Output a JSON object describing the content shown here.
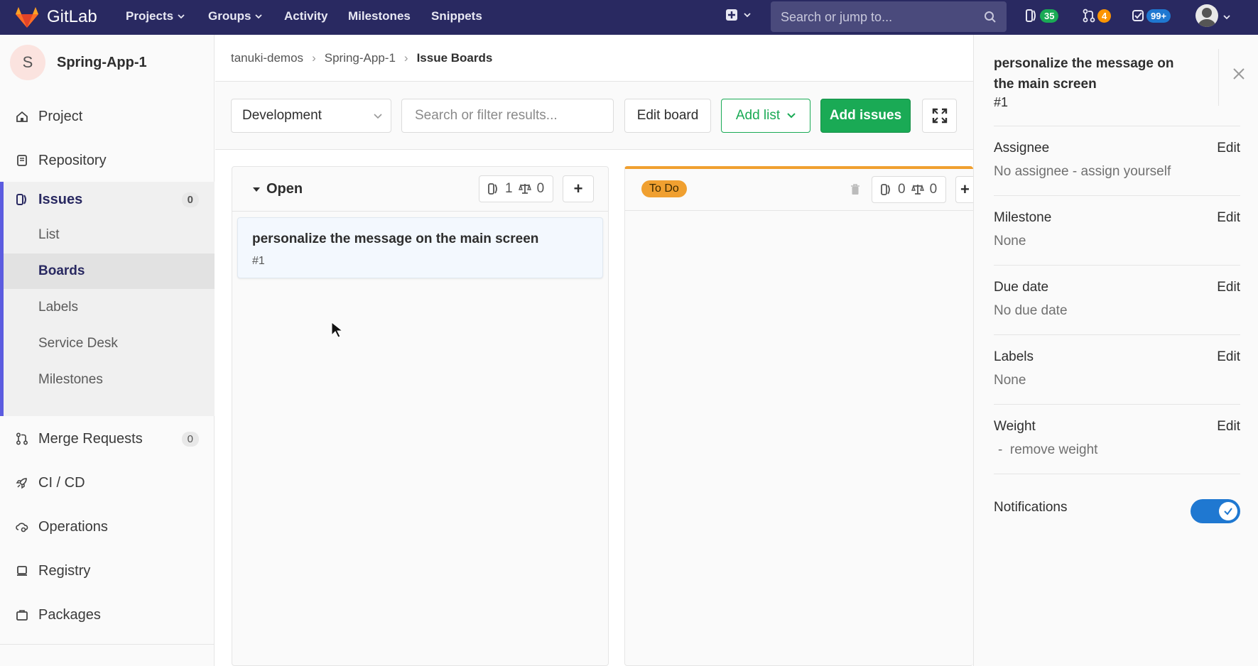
{
  "topnav": {
    "brand": "GitLab",
    "items": [
      "Projects",
      "Groups",
      "Activity",
      "Milestones",
      "Snippets"
    ],
    "search_placeholder": "Search or jump to...",
    "issues_count": "35",
    "mr_count": "4",
    "todos_count": "99+",
    "colors": {
      "bar": "#292961",
      "issues_badge": "#1aaa55",
      "mr_badge": "#fc9403",
      "todos_badge": "#1f78d1"
    }
  },
  "sidebar": {
    "project_initial": "S",
    "project_name": "Spring-App-1",
    "project": "Project",
    "repository": "Repository",
    "issues": "Issues",
    "issues_count": "0",
    "sub": [
      "List",
      "Boards",
      "Labels",
      "Service Desk",
      "Milestones"
    ],
    "merge_requests": "Merge Requests",
    "mr_count": "0",
    "cicd": "CI / CD",
    "operations": "Operations",
    "registry": "Registry",
    "packages": "Packages"
  },
  "breadcrumb": {
    "group": "tanuki-demos",
    "project": "Spring-App-1",
    "current": "Issue Boards"
  },
  "toolbar": {
    "board_select": "Development",
    "filter_placeholder": "Search or filter results...",
    "edit_board": "Edit board",
    "add_list": "Add list",
    "add_issues": "Add issues"
  },
  "lists": [
    {
      "title": "Open",
      "issues": "1",
      "weight": "0",
      "cards": [
        {
          "title": "personalize the message on the main screen",
          "number": "#1"
        }
      ]
    },
    {
      "title": "To Do",
      "issues": "0",
      "weight": "0",
      "label_color": "#f0a030"
    }
  ],
  "panel": {
    "title": "personalize the message on the main screen",
    "number": "#1",
    "edit": "Edit",
    "assignee_label": "Assignee",
    "assignee_value": "No assignee - assign yourself",
    "milestone_label": "Milestone",
    "milestone_value": "None",
    "due_label": "Due date",
    "due_value": "No due date",
    "labels_label": "Labels",
    "labels_value": "None",
    "weight_label": "Weight",
    "weight_value": "-  remove weight",
    "notifications_label": "Notifications",
    "notifications_on": true
  }
}
